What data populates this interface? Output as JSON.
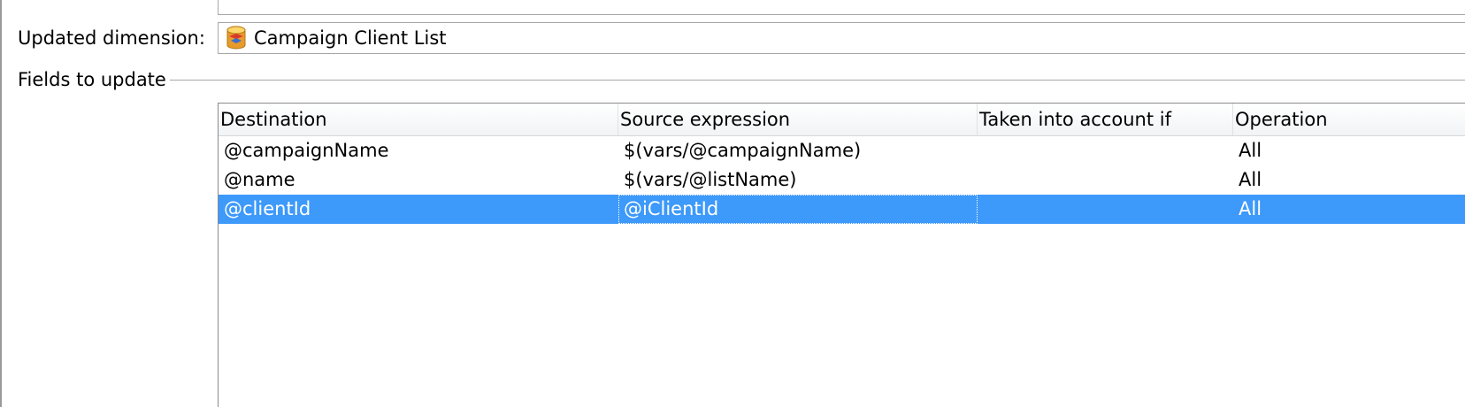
{
  "dimension": {
    "label": "Updated dimension:",
    "value": "Campaign Client List",
    "icon": "database-table-icon"
  },
  "fields_section": {
    "legend": "Fields to update"
  },
  "grid": {
    "columns": [
      "Destination",
      "Source expression",
      "Taken into account if",
      "Operation"
    ],
    "rows": [
      {
        "destination": "@campaignName",
        "source": "$(vars/@campaignName)",
        "condition": "",
        "operation": "All",
        "selected": false
      },
      {
        "destination": "@name",
        "source": "$(vars/@listName)",
        "condition": "",
        "operation": "All",
        "selected": false
      },
      {
        "destination": "@clientId",
        "source": "@iClientId",
        "condition": "",
        "operation": "All",
        "selected": true
      }
    ],
    "selection_color": "#3d99fa"
  }
}
